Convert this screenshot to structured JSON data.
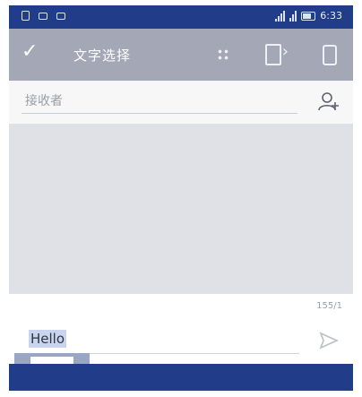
{
  "statusbar": {
    "time": "6:33"
  },
  "toolbar": {
    "title": "文字选择"
  },
  "recipient": {
    "placeholder": "接收者"
  },
  "compose": {
    "counter": "155/1",
    "message_value": "Hello"
  },
  "icons": {
    "check": "check-icon",
    "grid": "select-all-icon",
    "forward": "forward-icon",
    "delete": "delete-icon",
    "add_contact": "add-contact-icon",
    "send": "send-icon"
  },
  "colors": {
    "status_bar": "#213d8a",
    "toolbar": "#a3a7b6",
    "selection": "#c9d4ee"
  }
}
